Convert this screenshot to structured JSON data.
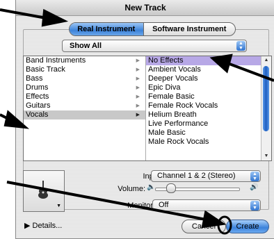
{
  "window": {
    "title": "New Track"
  },
  "tabs": [
    {
      "label": "Real Instrument",
      "selected": true
    },
    {
      "label": "Software Instrument",
      "selected": false
    }
  ],
  "filter_popup": {
    "value": "Show All"
  },
  "categories": [
    {
      "label": "Band Instruments",
      "selected": false
    },
    {
      "label": "Basic Track",
      "selected": false
    },
    {
      "label": "Bass",
      "selected": false
    },
    {
      "label": "Drums",
      "selected": false
    },
    {
      "label": "Effects",
      "selected": false
    },
    {
      "label": "Guitars",
      "selected": false
    },
    {
      "label": "Vocals",
      "selected": true
    }
  ],
  "presets": [
    {
      "label": "No Effects",
      "selected": true
    },
    {
      "label": "Ambient Vocals",
      "selected": false
    },
    {
      "label": "Deeper Vocals",
      "selected": false
    },
    {
      "label": "Epic Diva",
      "selected": false
    },
    {
      "label": "Female Basic",
      "selected": false
    },
    {
      "label": "Female Rock Vocals",
      "selected": false
    },
    {
      "label": "Helium Breath",
      "selected": false
    },
    {
      "label": "Live Performance",
      "selected": false
    },
    {
      "label": "Male Basic",
      "selected": false
    },
    {
      "label": "Male Rock Vocals",
      "selected": false
    }
  ],
  "controls": {
    "input_label": "Input:",
    "input_value": "Channel 1 & 2 (Stereo)",
    "volume_label": "Volume:",
    "volume_level": 0.15,
    "monitor_label": "Monitor:",
    "monitor_value": "Off"
  },
  "footer": {
    "details_label": "Details...",
    "cancel_label": "Cancel",
    "create_label": "Create"
  },
  "colors": {
    "accent": "#3d83d9",
    "selection_purple": "#b7a8e6",
    "category_selection": "#c8c8c8"
  },
  "icons": {
    "instrument_icon": "guitar-icon",
    "popup_arrow": "updown-arrows-icon",
    "details_arrow": "disclosure-triangle-icon",
    "volume_low": "speaker-low-icon",
    "volume_high": "speaker-high-icon"
  }
}
